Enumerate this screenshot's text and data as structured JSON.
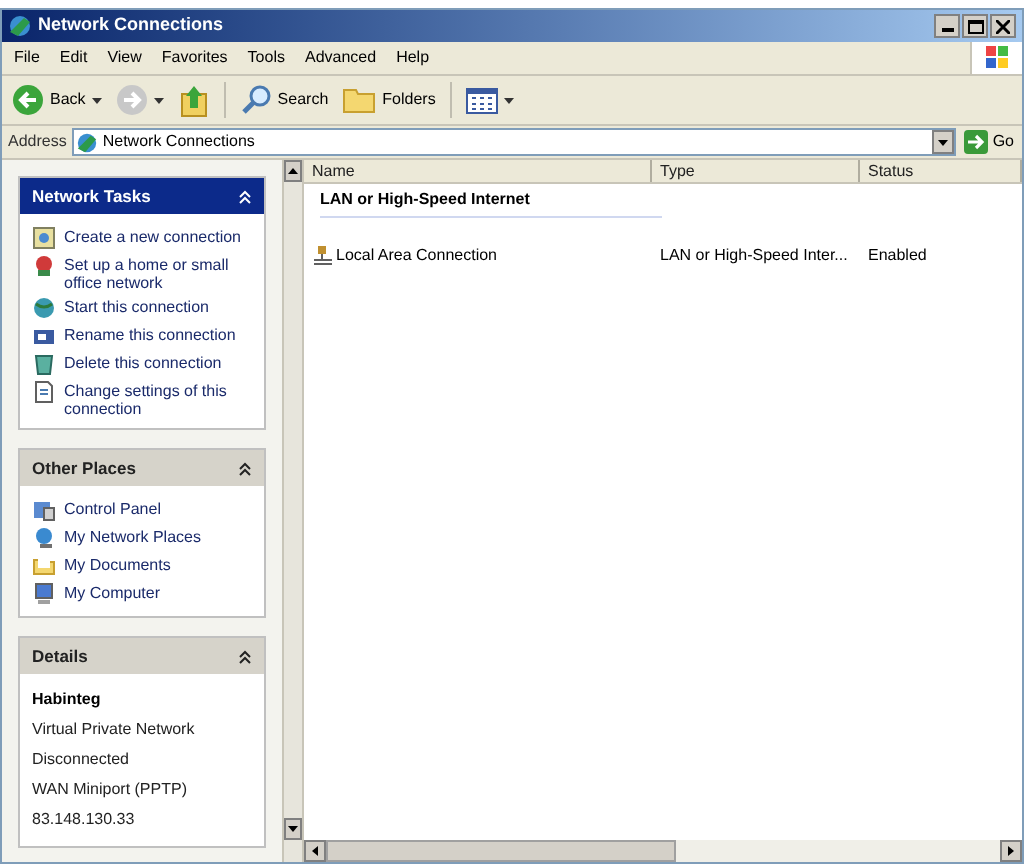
{
  "window": {
    "title": "Network Connections"
  },
  "menu": [
    "File",
    "Edit",
    "View",
    "Favorites",
    "Tools",
    "Advanced",
    "Help"
  ],
  "toolbar": [
    {
      "kind": "back",
      "label": "Back"
    },
    {
      "kind": "forward"
    },
    {
      "kind": "up"
    },
    {
      "kind": "search",
      "label": "Search"
    },
    {
      "kind": "folders",
      "label": "Folders"
    },
    {
      "kind": "views"
    }
  ],
  "address": {
    "label": "Address",
    "value": "Network Connections",
    "go": "Go"
  },
  "panels": [
    {
      "kind": "tasks",
      "title": "Network Tasks",
      "items": [
        "Create a new connection",
        "Set up a home or small office network",
        "Start this connection",
        "Rename this connection",
        "Delete this connection",
        "Change settings of this connection"
      ]
    },
    {
      "kind": "places",
      "title": "Other Places",
      "items": [
        "Control Panel",
        "My Network Places",
        "My Documents",
        "My Computer"
      ]
    },
    {
      "kind": "details",
      "title": "Details",
      "name": "Habinteg",
      "lines": [
        "Virtual Private Network",
        "Disconnected",
        "WAN Miniport (PPTP)",
        "83.148.130.33"
      ]
    }
  ],
  "table": {
    "columns": [
      "Name",
      "Type",
      "Status"
    ],
    "groups": [
      {
        "title": "LAN or High-Speed Internet",
        "rows": [
          {
            "name": "Local Area Connection",
            "type": "LAN or High-Speed Inter...",
            "status": "Enabled"
          }
        ]
      }
    ]
  }
}
